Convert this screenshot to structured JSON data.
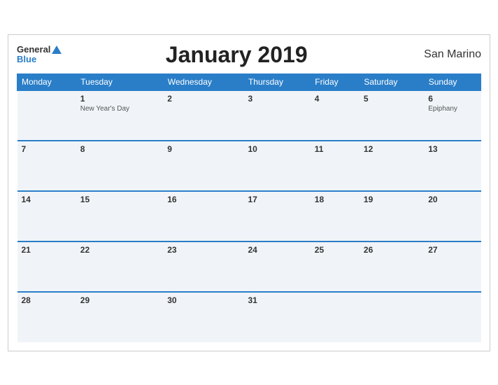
{
  "header": {
    "title": "January 2019",
    "country": "San Marino",
    "logo_general": "General",
    "logo_blue": "Blue"
  },
  "days_of_week": [
    "Monday",
    "Tuesday",
    "Wednesday",
    "Thursday",
    "Friday",
    "Saturday",
    "Sunday"
  ],
  "weeks": [
    {
      "days": [
        {
          "date": "",
          "event": ""
        },
        {
          "date": "1",
          "event": "New Year's Day"
        },
        {
          "date": "2",
          "event": ""
        },
        {
          "date": "3",
          "event": ""
        },
        {
          "date": "4",
          "event": ""
        },
        {
          "date": "5",
          "event": ""
        },
        {
          "date": "6",
          "event": "Epiphany"
        }
      ]
    },
    {
      "days": [
        {
          "date": "7",
          "event": ""
        },
        {
          "date": "8",
          "event": ""
        },
        {
          "date": "9",
          "event": ""
        },
        {
          "date": "10",
          "event": ""
        },
        {
          "date": "11",
          "event": ""
        },
        {
          "date": "12",
          "event": ""
        },
        {
          "date": "13",
          "event": ""
        }
      ]
    },
    {
      "days": [
        {
          "date": "14",
          "event": ""
        },
        {
          "date": "15",
          "event": ""
        },
        {
          "date": "16",
          "event": ""
        },
        {
          "date": "17",
          "event": ""
        },
        {
          "date": "18",
          "event": ""
        },
        {
          "date": "19",
          "event": ""
        },
        {
          "date": "20",
          "event": ""
        }
      ]
    },
    {
      "days": [
        {
          "date": "21",
          "event": ""
        },
        {
          "date": "22",
          "event": ""
        },
        {
          "date": "23",
          "event": ""
        },
        {
          "date": "24",
          "event": ""
        },
        {
          "date": "25",
          "event": ""
        },
        {
          "date": "26",
          "event": ""
        },
        {
          "date": "27",
          "event": ""
        }
      ]
    },
    {
      "days": [
        {
          "date": "28",
          "event": ""
        },
        {
          "date": "29",
          "event": ""
        },
        {
          "date": "30",
          "event": ""
        },
        {
          "date": "31",
          "event": ""
        },
        {
          "date": "",
          "event": ""
        },
        {
          "date": "",
          "event": ""
        },
        {
          "date": "",
          "event": ""
        }
      ]
    }
  ]
}
